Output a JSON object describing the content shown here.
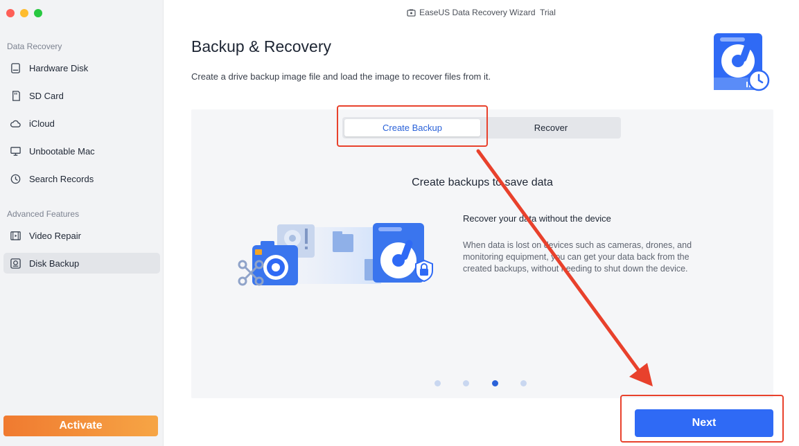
{
  "window": {
    "title": "EaseUS Data Recovery Wizard  Trial"
  },
  "sidebar": {
    "sections": [
      {
        "title": "Data Recovery",
        "items": [
          {
            "label": "Hardware Disk",
            "icon": "hardware-disk-icon"
          },
          {
            "label": "SD Card",
            "icon": "sd-card-icon"
          },
          {
            "label": "iCloud",
            "icon": "cloud-icon"
          },
          {
            "label": "Unbootable Mac",
            "icon": "monitor-icon"
          },
          {
            "label": "Search Records",
            "icon": "clock-icon"
          }
        ]
      },
      {
        "title": "Advanced Features",
        "items": [
          {
            "label": "Video Repair",
            "icon": "film-icon"
          },
          {
            "label": "Disk Backup",
            "icon": "disk-backup-icon",
            "active": true
          }
        ]
      }
    ],
    "activate_label": "Activate"
  },
  "main": {
    "title": "Backup & Recovery",
    "description": "Create a drive backup image file and load the image to recover files from it.",
    "tabs": [
      {
        "label": "Create Backup",
        "active": true
      },
      {
        "label": "Recover",
        "active": false
      }
    ],
    "slide": {
      "heading": "Create backups to save data",
      "subheading": "Recover your data without the device",
      "body": "When data is lost on devices such as cameras, drones, and monitoring equipment, you can get your data back from the created backups, without needing to shut down the device."
    },
    "carousel": {
      "count": 4,
      "active_index": 2
    },
    "next_label": "Next"
  },
  "colors": {
    "accent": "#2f6af5",
    "activate": "#f07a30",
    "annotation": "#e8412c"
  }
}
